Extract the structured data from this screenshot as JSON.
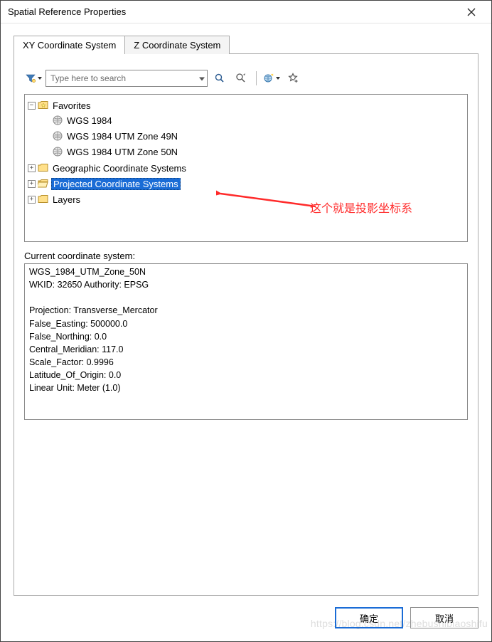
{
  "window": {
    "title": "Spatial Reference Properties"
  },
  "tabs": {
    "active": "XY Coordinate System",
    "inactive": "Z Coordinate System"
  },
  "toolbar": {
    "search_placeholder": "Type here to search"
  },
  "tree": {
    "favorites_label": "Favorites",
    "favorites_items": [
      "WGS 1984",
      "WGS 1984 UTM Zone 49N",
      "WGS 1984 UTM Zone 50N"
    ],
    "gcs_label": "Geographic Coordinate Systems",
    "pcs_label": "Projected Coordinate Systems",
    "layers_label": "Layers"
  },
  "current": {
    "label": "Current coordinate system:",
    "text": "WGS_1984_UTM_Zone_50N\nWKID: 32650 Authority: EPSG\n\nProjection: Transverse_Mercator\nFalse_Easting: 500000.0\nFalse_Northing: 0.0\nCentral_Meridian: 117.0\nScale_Factor: 0.9996\nLatitude_Of_Origin: 0.0\nLinear Unit: Meter (1.0)\n"
  },
  "buttons": {
    "ok": "确定",
    "cancel": "取消"
  },
  "annotation": {
    "text": "这个就是投影坐标系"
  },
  "watermark": "https://blog.csdn.net/zhebushibiaoshifu"
}
